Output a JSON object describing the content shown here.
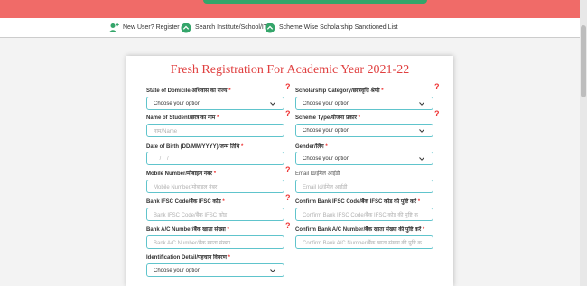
{
  "nav": {
    "new_user": "New User? Register",
    "search": "Search Institute/School/ITI",
    "scheme_list": "Scheme Wise Scholarship Sanctioned List"
  },
  "colors": {
    "banner": "#f06b68",
    "accent_green": "#34a56a",
    "title_red": "#e04040",
    "input_border": "#60c4cc"
  },
  "form": {
    "title": "Fresh Registration For Academic Year 2021-22",
    "required_marker": "*",
    "help_marker": "?",
    "fields": {
      "domicile": {
        "label": "State of Domicile/अधिवास का राज्य",
        "value": "Choose your option"
      },
      "category": {
        "label": "Scholarship Category/छात्रवृत्ति श्रेणी",
        "value": "Choose your option"
      },
      "student_name": {
        "label": "Name of Student/छात्र का नाम",
        "placeholder": "नाम/Name"
      },
      "scheme_type": {
        "label": "Scheme Type/योजना प्रकार",
        "value": "Choose your option"
      },
      "dob": {
        "label": "Date of Birth (DD/MM/YYYY)/जन्म तिथि",
        "placeholder": "__/__/____"
      },
      "gender": {
        "label": "Gender/लिंग",
        "value": "Choose your option"
      },
      "mobile": {
        "label": "Mobile Number/मोबाइल नंबर",
        "placeholder": "Mobile Number/मोबाइल नंबर"
      },
      "email": {
        "label": "Email Id/ईमेल आईडी",
        "placeholder": "Email Id/ईमेल आईडी"
      },
      "ifsc": {
        "label": "Bank IFSC Code/बैंक IFSC कोड",
        "placeholder": "Bank IFSC Code/बैंक IFSC कोड"
      },
      "confirm_ifsc": {
        "label": "Confirm Bank IFSC Code/बैंक IFSC कोड की पुष्टि करें",
        "placeholder": "Confirm Bank IFSC Code/बैंक IFSC कोड की पुष्टि क"
      },
      "account": {
        "label": "Bank A/C Number/बैंक खाता संख्या",
        "placeholder": "Bank A/C Number/बैंक खाता संख्या"
      },
      "confirm_account": {
        "label": "Confirm Bank A/C Number/बैंक खाता संख्या की पुष्टि करें",
        "placeholder": "Confirm Bank A/C Number/बैंक खाता संख्या की पुष्टि क"
      },
      "id_detail": {
        "label": "Identification Detail/पहचान विवरण",
        "value": "Choose your option"
      }
    }
  }
}
